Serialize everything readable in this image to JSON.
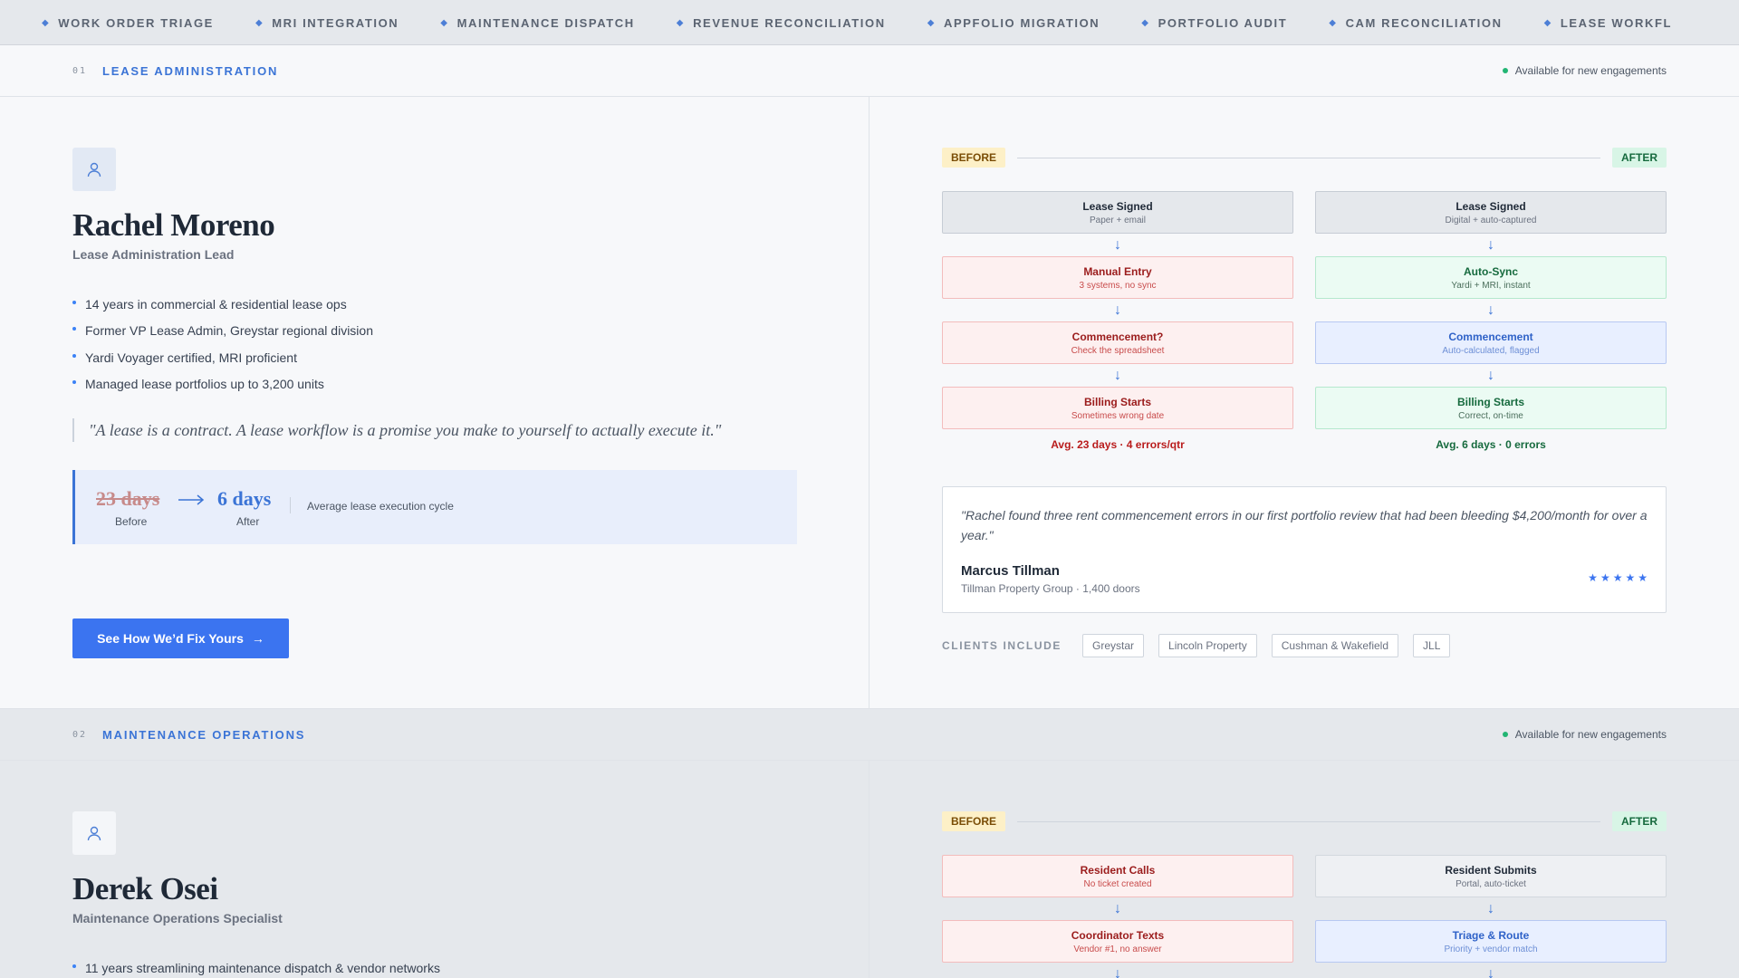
{
  "ticker": [
    "WORK ORDER TRIAGE",
    "MRI INTEGRATION",
    "MAINTENANCE DISPATCH",
    "REVENUE RECONCILIATION",
    "APPFOLIO MIGRATION",
    "PORTFOLIO AUDIT",
    "CAM RECONCILIATION",
    "LEASE WORKFL"
  ],
  "colors": {
    "accent": "#3b74d6",
    "button": "#3b74f0",
    "available_dot": "#22b573",
    "before_badge": "#fdf0c7",
    "after_badge": "#d8f5e6"
  },
  "section1": {
    "num": "01",
    "title": "LEASE ADMINISTRATION",
    "availability": "Available for new engagements",
    "avatar_icon": "user-icon",
    "name": "Rachel Moreno",
    "role": "Lease Administration Lead",
    "bullets": [
      "14 years in commercial & residential lease ops",
      "Former VP Lease Admin, Greystar regional division",
      "Yardi Voyager certified, MRI proficient",
      "Managed lease portfolios up to 3,200 units"
    ],
    "quote": "\"A lease is a contract. A lease workflow is a promise you make to yourself to actually execute it.\"",
    "metric": {
      "before_value": "23 days",
      "before_label": "Before",
      "after_value": "6 days",
      "after_label": "After",
      "description": "Average lease execution cycle"
    },
    "cta": "See How We’d Fix Yours",
    "before_label": "BEFORE",
    "after_label": "AFTER",
    "before_steps": [
      {
        "title": "Lease Signed",
        "sub": "Paper + email",
        "style": "gray"
      },
      {
        "title": "Manual Entry",
        "sub": "3 systems, no sync",
        "style": "red"
      },
      {
        "title": "Commencement?",
        "sub": "Check the spreadsheet",
        "style": "red"
      },
      {
        "title": "Billing Starts",
        "sub": "Sometimes wrong date",
        "style": "red"
      }
    ],
    "after_steps": [
      {
        "title": "Lease Signed",
        "sub": "Digital + auto-captured",
        "style": "gray"
      },
      {
        "title": "Auto-Sync",
        "sub": "Yardi + MRI, instant",
        "style": "green"
      },
      {
        "title": "Commencement",
        "sub": "Auto-calculated, flagged",
        "style": "blue"
      },
      {
        "title": "Billing Starts",
        "sub": "Correct, on-time",
        "style": "green"
      }
    ],
    "before_summary": "Avg. 23 days · 4 errors/qtr",
    "after_summary": "Avg. 6 days · 0 errors",
    "testimonial": {
      "quote": "\"Rachel found three rent commencement errors in our first portfolio review that had been bleeding $4,200/month for over a year.\"",
      "author": "Marcus Tillman",
      "org": "Tillman Property Group · 1,400 doors",
      "rating": 5,
      "star": "★"
    },
    "clients_label": "CLIENTS INCLUDE",
    "clients": [
      "Greystar",
      "Lincoln Property",
      "Cushman & Wakefield",
      "JLL"
    ]
  },
  "section2": {
    "num": "02",
    "title": "MAINTENANCE OPERATIONS",
    "availability": "Available for new engagements",
    "avatar_icon": "user-icon",
    "name": "Derek Osei",
    "role": "Maintenance Operations Specialist",
    "bullets": [
      "11 years streamlining maintenance dispatch & vendor networks"
    ],
    "before_label": "BEFORE",
    "after_label": "AFTER",
    "before_steps": [
      {
        "title": "Resident Calls",
        "sub": "No ticket created",
        "style": "red"
      },
      {
        "title": "Coordinator Texts",
        "sub": "Vendor #1, no answer",
        "style": "red"
      }
    ],
    "after_steps": [
      {
        "title": "Resident Submits",
        "sub": "Portal, auto-ticket",
        "style": "graylight"
      },
      {
        "title": "Triage & Route",
        "sub": "Priority + vendor match",
        "style": "blue"
      }
    ]
  }
}
